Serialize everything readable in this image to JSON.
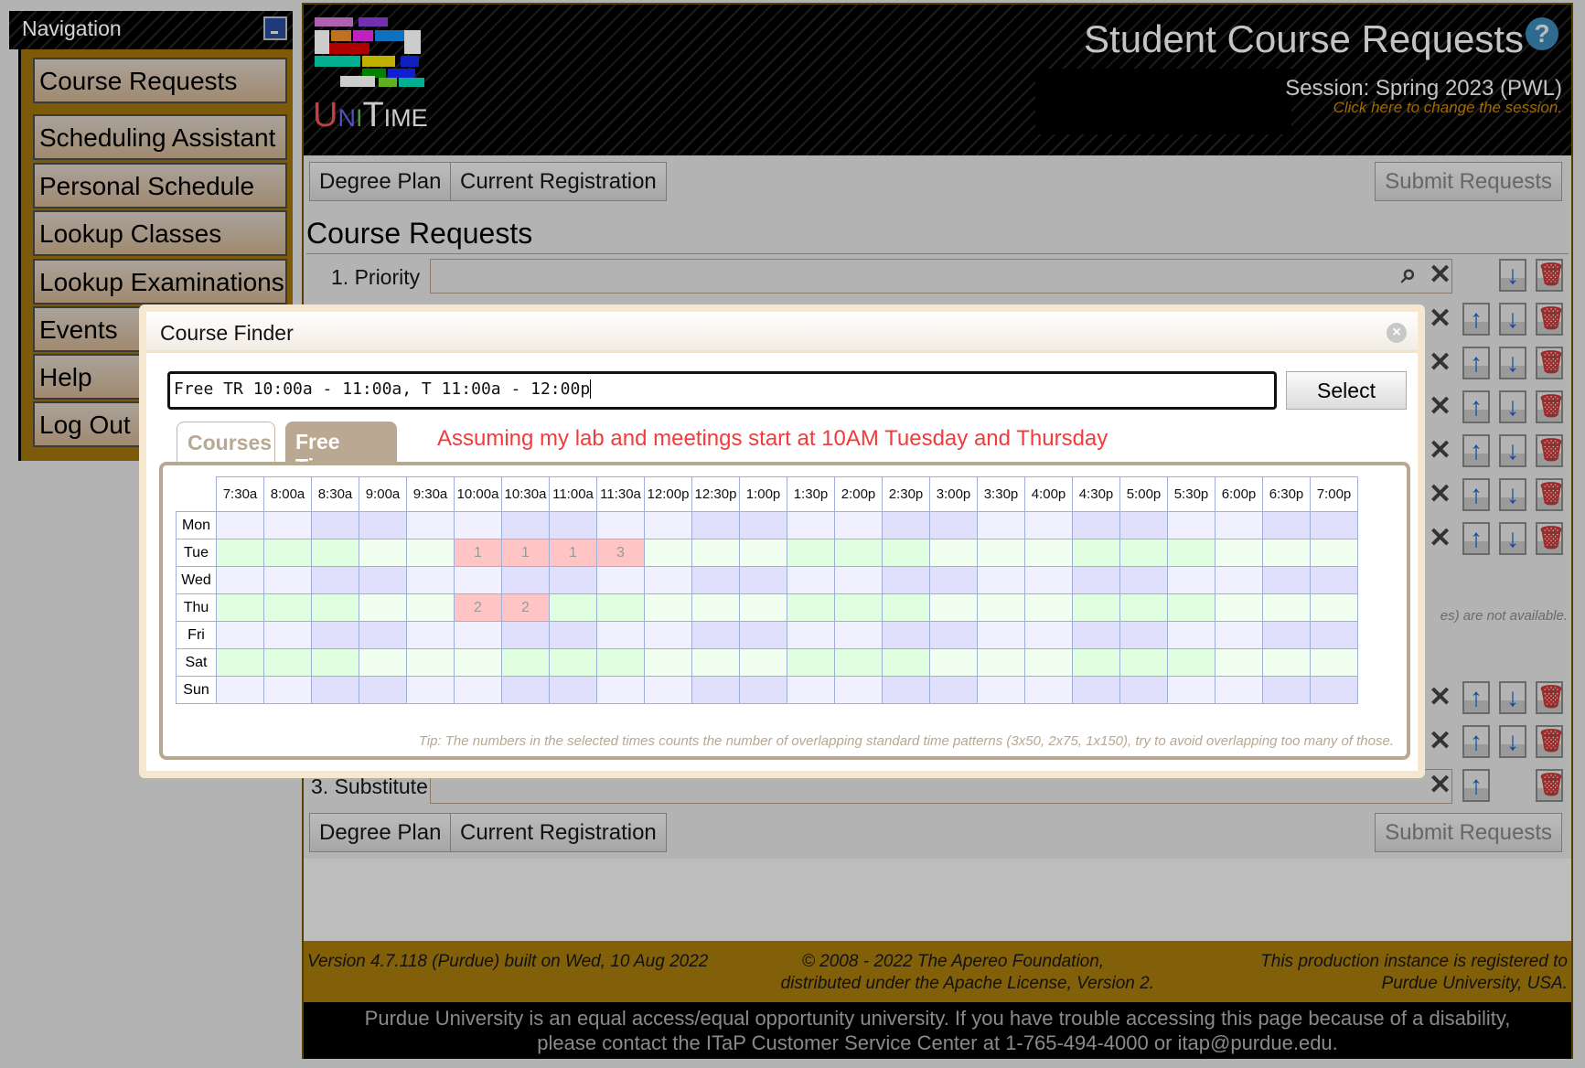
{
  "navigation": {
    "title": "Navigation",
    "items": [
      "Course Requests",
      "Scheduling Assistant",
      "Personal Schedule",
      "Lookup Classes",
      "Lookup Examinations",
      "Events",
      "Help",
      "Log Out"
    ]
  },
  "header": {
    "title": "Student Course Requests",
    "logo_text": "UniTime",
    "session": "Session: Spring 2023 (PWL)",
    "change_session": "Click here to change the session."
  },
  "toolbar": {
    "degree_plan": "Degree Plan",
    "current_registration": "Current Registration",
    "submit": "Submit Requests"
  },
  "page": {
    "title": "Course Requests",
    "row1_label": "1. Priority",
    "row_sub_label": "3. Substitute",
    "not_available_note": "es) are not available."
  },
  "dialog": {
    "title": "Course Finder",
    "input_value": "Free TR 10:00a - 11:00a, T 11:00a - 12:00p",
    "select": "Select",
    "tabs": [
      "Courses",
      "Free Time"
    ],
    "active_tab": "Free Time",
    "annotation": "Assuming my lab and meetings start at 10AM Tuesday and Thursday",
    "tip": "Tip: The numbers in the selected times counts the number of overlapping standard time patterns (3x50, 2x75, 1x150), try to avoid overlapping too many of those.",
    "times": [
      "7:30a",
      "8:00a",
      "8:30a",
      "9:00a",
      "9:30a",
      "10:00a",
      "10:30a",
      "11:00a",
      "11:30a",
      "12:00p",
      "12:30p",
      "1:00p",
      "1:30p",
      "2:00p",
      "2:30p",
      "3:00p",
      "3:30p",
      "4:00p",
      "4:30p",
      "5:00p",
      "5:30p",
      "6:00p",
      "6:30p",
      "7:00p"
    ],
    "days": [
      "Mon",
      "Tue",
      "Wed",
      "Thu",
      "Fri",
      "Sat",
      "Sun"
    ],
    "selected": [
      {
        "day": "Tue",
        "time": "10:00a",
        "count": "1"
      },
      {
        "day": "Tue",
        "time": "10:30a",
        "count": "1"
      },
      {
        "day": "Tue",
        "time": "11:00a",
        "count": "1"
      },
      {
        "day": "Tue",
        "time": "11:30a",
        "count": "3"
      },
      {
        "day": "Thu",
        "time": "10:00a",
        "count": "2"
      },
      {
        "day": "Thu",
        "time": "10:30a",
        "count": "2"
      }
    ]
  },
  "footer": {
    "version": "Version 4.7.118 (Purdue) built on Wed, 10 Aug 2022",
    "copyright1": "© 2008 - 2022 The Apereo Foundation,",
    "copyright2": "distributed under the Apache License, Version 2.",
    "registered1": "This production instance is registered to",
    "registered2": "Purdue University, USA.",
    "equal1": "Purdue University is an equal access/equal opportunity university. If you have trouble accessing this page because of a disability,",
    "equal2": "please contact the ITaP Customer Service Center at 1-765-494-4000 or itap@purdue.edu."
  },
  "colors": {
    "selected": "#ffc4c4",
    "mwf_light": "#f0f0ff",
    "mwf_dark": "#e0e0fc",
    "tr_light": "#f0fff0",
    "tr_dark": "#e0ffe0",
    "note": "#f03c3c",
    "footer_gold": "#82600a"
  }
}
